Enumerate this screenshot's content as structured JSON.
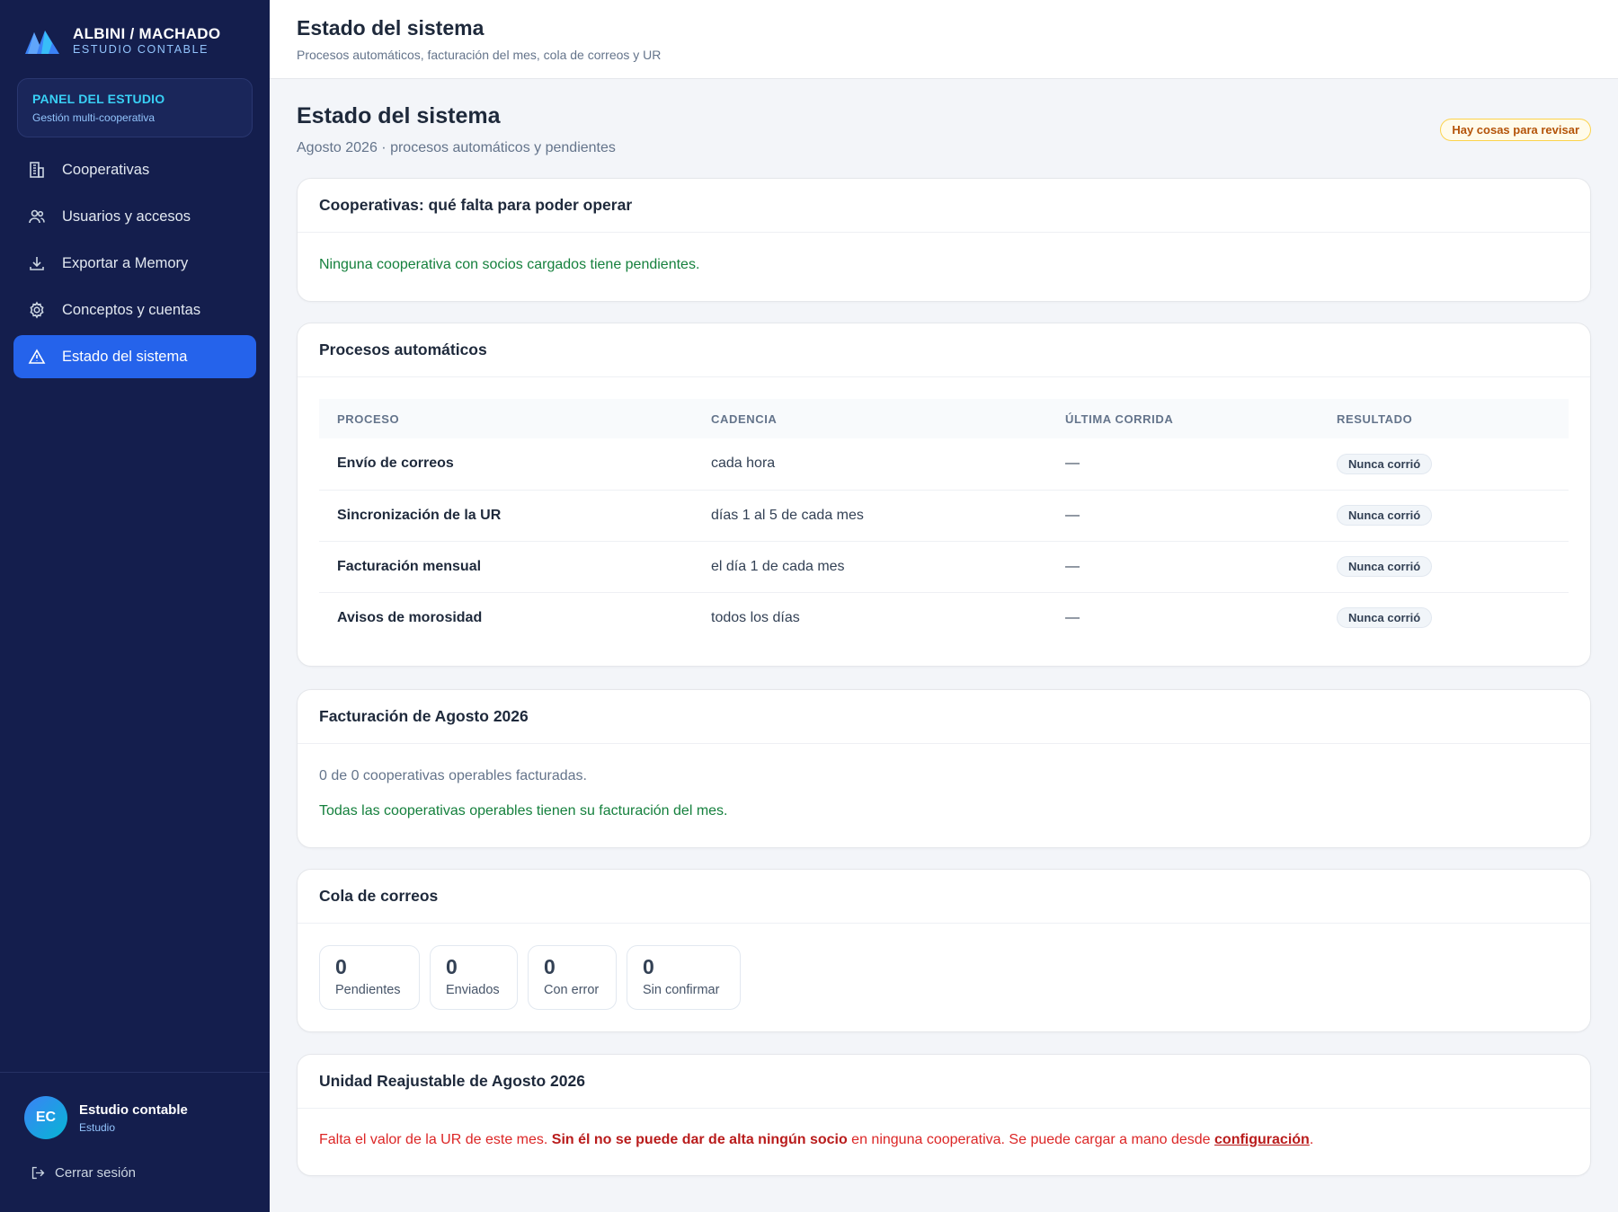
{
  "brand": {
    "name": "ALBINI / MACHADO",
    "sub": "ESTUDIO CONTABLE"
  },
  "panel": {
    "title": "PANEL DEL ESTUDIO",
    "sub": "Gestión multi-cooperativa"
  },
  "nav": [
    {
      "label": "Cooperativas",
      "icon": "building-icon"
    },
    {
      "label": "Usuarios y accesos",
      "icon": "users-icon"
    },
    {
      "label": "Exportar a Memory",
      "icon": "download-icon"
    },
    {
      "label": "Conceptos y cuentas",
      "icon": "gear-icon"
    },
    {
      "label": "Estado del sistema",
      "icon": "warning-icon",
      "active": true
    }
  ],
  "user": {
    "initials": "EC",
    "name": "Estudio contable",
    "role": "Estudio"
  },
  "logout_label": "Cerrar sesión",
  "topbar": {
    "title": "Estado del sistema",
    "sub": "Procesos automáticos, facturación del mes, cola de correos y UR"
  },
  "page": {
    "title": "Estado del sistema",
    "sub": "Agosto 2026 · procesos automáticos y pendientes",
    "badge": "Hay cosas para revisar"
  },
  "coops": {
    "title": "Cooperativas: qué falta para poder operar",
    "message": "Ninguna cooperativa con socios cargados tiene pendientes."
  },
  "procesos": {
    "title": "Procesos automáticos",
    "headers": [
      "PROCESO",
      "CADENCIA",
      "ÚLTIMA CORRIDA",
      "RESULTADO"
    ],
    "rows": [
      {
        "proceso": "Envío de correos",
        "cadencia": "cada hora",
        "ultima": "—",
        "resultado": "Nunca corrió"
      },
      {
        "proceso": "Sincronización de la UR",
        "cadencia": "días 1 al 5 de cada mes",
        "ultima": "—",
        "resultado": "Nunca corrió"
      },
      {
        "proceso": "Facturación mensual",
        "cadencia": "el día 1 de cada mes",
        "ultima": "—",
        "resultado": "Nunca corrió"
      },
      {
        "proceso": "Avisos de morosidad",
        "cadencia": "todos los días",
        "ultima": "—",
        "resultado": "Nunca corrió"
      }
    ]
  },
  "facturacion": {
    "title": "Facturación de Agosto 2026",
    "count": "0 de 0 cooperativas operables facturadas.",
    "message": "Todas las cooperativas operables tienen su facturación del mes."
  },
  "cola": {
    "title": "Cola de correos",
    "stats": [
      {
        "value": "0",
        "label": "Pendientes"
      },
      {
        "value": "0",
        "label": "Enviados"
      },
      {
        "value": "0",
        "label": "Con error"
      },
      {
        "value": "0",
        "label": "Sin confirmar"
      }
    ]
  },
  "ur": {
    "title": "Unidad Reajustable de Agosto 2026",
    "msg_1": "Falta el valor de la UR de este mes. ",
    "msg_bold": "Sin él no se puede dar de alta ningún socio",
    "msg_2": " en ninguna cooperativa. Se puede cargar a mano desde ",
    "msg_link": "configuración",
    "msg_3": "."
  },
  "colors": {
    "sidebar": "#141e4d",
    "accent": "#2563eb",
    "ok": "#15803d",
    "error": "#dc2626",
    "warn": "#b45309"
  }
}
